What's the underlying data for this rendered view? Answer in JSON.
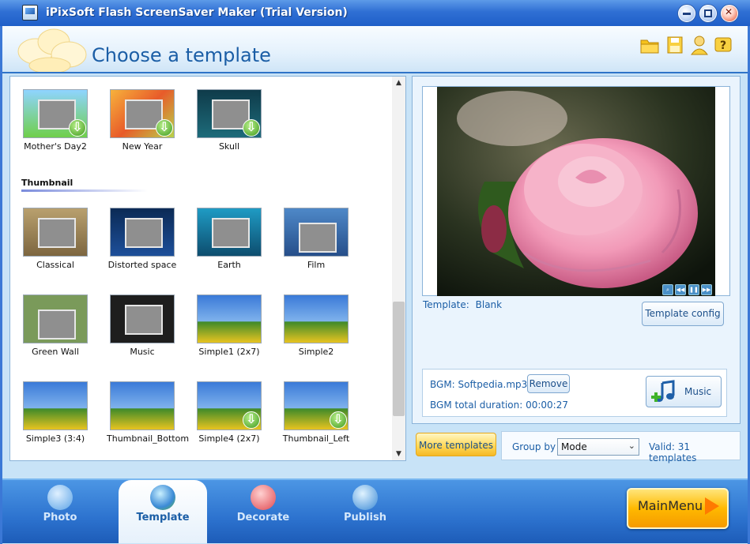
{
  "window": {
    "title": "iPixSoft Flash ScreenSaver Maker (Trial Version)"
  },
  "header": {
    "title": "Choose a template",
    "icons": [
      "folder-icon",
      "save-icon",
      "user-icon",
      "help-icon"
    ]
  },
  "templates": {
    "top_row": [
      {
        "name": "Mother's Day2",
        "downloadable": true
      },
      {
        "name": "New Year",
        "downloadable": true
      },
      {
        "name": "Skull",
        "downloadable": true
      }
    ],
    "section_label": "Thumbnail",
    "rows": [
      [
        {
          "name": "Classical"
        },
        {
          "name": "Distorted space"
        },
        {
          "name": "Earth"
        },
        {
          "name": "Film"
        }
      ],
      [
        {
          "name": "Green Wall"
        },
        {
          "name": "Music"
        },
        {
          "name": "Simple1 (2x7)"
        },
        {
          "name": "Simple2"
        }
      ],
      [
        {
          "name": "Simple3 (3:4)"
        },
        {
          "name": "Thumbnail_Bottom"
        },
        {
          "name": "Simple4 (2x7)",
          "downloadable": true
        },
        {
          "name": "Thumbnail_Left",
          "downloadable": true
        }
      ]
    ]
  },
  "preview": {
    "template_label": "Template:",
    "template_value": "Blank",
    "template_config_label": "Template config"
  },
  "bgm": {
    "file_label": "BGM: Softpedia.mp3",
    "remove_label": "Remove",
    "duration_label": "BGM total duration: 00:00:27",
    "music_label": "Music"
  },
  "controls": {
    "more_templates_label": "More templates",
    "group_by_label": "Group by",
    "group_by_value": "Mode",
    "valid_text": "Valid: 31 templates"
  },
  "nav": {
    "tabs": [
      {
        "label": "Photo",
        "active": false
      },
      {
        "label": "Template",
        "active": true
      },
      {
        "label": "Decorate",
        "active": false
      },
      {
        "label": "Publish",
        "active": false
      }
    ],
    "main_menu_label": "MainMenu"
  },
  "colors": {
    "accent": "#1b5ea6",
    "titlebar": "#2f6fd4",
    "more_button": "#ffd95a"
  }
}
